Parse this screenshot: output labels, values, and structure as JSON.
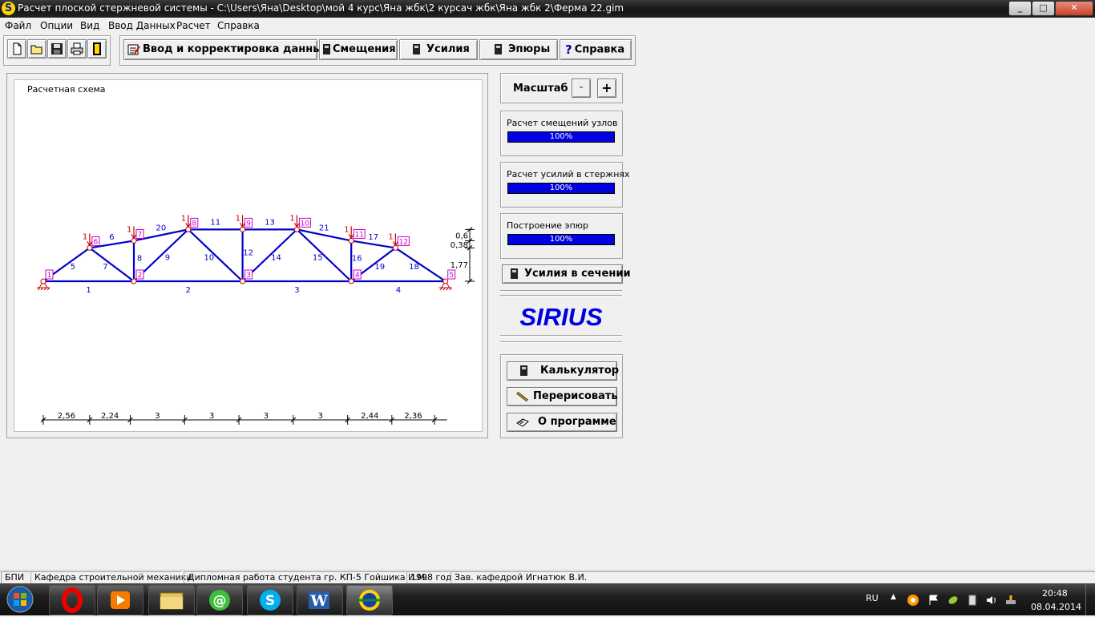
{
  "window": {
    "title": "Расчет плоской стержневой системы - C:\\Users\\Яна\\Desktop\\мой 4 курс\\Яна жбк\\2 курсач жбк\\Яна жбк 2\\Ферма 22.gim",
    "app_icon_letter": "S",
    "minimize": "_",
    "maximize": "□",
    "close": "✕"
  },
  "menu": [
    "Файл",
    "Опции",
    "Вид",
    "Ввод Данных",
    "Расчет",
    "Справка"
  ],
  "toolbar": {
    "file_buttons": [
      "new-file-icon",
      "open-folder-icon",
      "save-disk-icon",
      "print-icon",
      "exit-door-icon"
    ],
    "input_label": "Ввод и корректировка данных",
    "displacements_label": "Смещения",
    "forces_label": "Усилия",
    "diagrams_label": "Эпюры",
    "help_label": "Справка"
  },
  "canvas": {
    "title": "Расчетная схема"
  },
  "truss": {
    "colors": {
      "member": "#0000c8",
      "load": "#c80000",
      "label": "#c800c8",
      "dims": "#000000"
    },
    "loads_value": "1",
    "nodes": [
      {
        "id": "1",
        "x": 0,
        "y": 0
      },
      {
        "id": "2",
        "x": 5.0,
        "y": 0
      },
      {
        "id": "3",
        "x": 11.0,
        "y": 0
      },
      {
        "id": "4",
        "x": 17.0,
        "y": 0
      },
      {
        "id": "5",
        "x": 22.2,
        "y": 0
      },
      {
        "id": "6",
        "x": 2.56,
        "y": 1.77
      },
      {
        "id": "7",
        "x": 5.0,
        "y": 2.15
      },
      {
        "id": "8",
        "x": 8.0,
        "y": 2.75
      },
      {
        "id": "9",
        "x": 11.0,
        "y": 2.75
      },
      {
        "id": "10",
        "x": 14.0,
        "y": 2.75
      },
      {
        "id": "11",
        "x": 17.0,
        "y": 2.15
      },
      {
        "id": "12",
        "x": 19.44,
        "y": 1.77
      }
    ],
    "members": [
      {
        "id": "1",
        "from": "1",
        "to": "2"
      },
      {
        "id": "2",
        "from": "2",
        "to": "3"
      },
      {
        "id": "3",
        "from": "3",
        "to": "4"
      },
      {
        "id": "4",
        "from": "4",
        "to": "5"
      },
      {
        "id": "5",
        "from": "1",
        "to": "6"
      },
      {
        "id": "6",
        "from": "6",
        "to": "7"
      },
      {
        "id": "7",
        "from": "6",
        "to": "2"
      },
      {
        "id": "8",
        "from": "2",
        "to": "7"
      },
      {
        "id": "9",
        "from": "2",
        "to": "8"
      },
      {
        "id": "20",
        "from": "7",
        "to": "8"
      },
      {
        "id": "10",
        "from": "8",
        "to": "3"
      },
      {
        "id": "11",
        "from": "8",
        "to": "9"
      },
      {
        "id": "12",
        "from": "3",
        "to": "9"
      },
      {
        "id": "13",
        "from": "9",
        "to": "10"
      },
      {
        "id": "14",
        "from": "3",
        "to": "10"
      },
      {
        "id": "15",
        "from": "10",
        "to": "4"
      },
      {
        "id": "21",
        "from": "10",
        "to": "11"
      },
      {
        "id": "16",
        "from": "4",
        "to": "11"
      },
      {
        "id": "17",
        "from": "11",
        "to": "12"
      },
      {
        "id": "19",
        "from": "4",
        "to": "12"
      },
      {
        "id": "18",
        "from": "12",
        "to": "5"
      }
    ],
    "loaded_nodes": [
      "6",
      "7",
      "8",
      "9",
      "10",
      "11",
      "12"
    ],
    "supports": [
      "1",
      "5"
    ],
    "bottom_dims": [
      "2,56",
      "2,24",
      "3",
      "3",
      "3",
      "3",
      "2,44",
      "2,36"
    ],
    "bottom_dim_lengths": [
      2.56,
      2.24,
      3,
      3,
      3,
      3,
      2.44,
      2.36
    ],
    "side_dims": [
      "0,6",
      "0,38",
      "1,77"
    ],
    "side_dim_lengths": [
      0.6,
      0.38,
      1.77
    ]
  },
  "scale": {
    "label": "Масштаб",
    "minus": "-",
    "plus": "+"
  },
  "progress": [
    {
      "label": "Расчет смещений узлов",
      "value": "100%",
      "fraction": 1.0
    },
    {
      "label": "Расчет усилий в стержнях",
      "value": "100%",
      "fraction": 1.0
    },
    {
      "label": "Построение эпюр",
      "value": "100%",
      "fraction": 1.0
    }
  ],
  "section_forces_label": "Усилия в сечении",
  "brand": "SIRIUS",
  "tools": {
    "calculator_label": "Калькулятор",
    "redraw_label": "Перерисовать",
    "about_label": "О программе"
  },
  "status": [
    "БПИ",
    "Кафедра строительной механики",
    "Дипломная работа студента гр. КП-5 Гойшика И.М.",
    "1998 год",
    "Зав. кафедрой Игнатюк В.И."
  ],
  "taskbar": {
    "apps": [
      "start-orb-icon",
      "opera-icon",
      "media-player-icon",
      "explorer-folder-icon",
      "mail-agent-icon",
      "skype-icon",
      "word-icon",
      "sirius-icon"
    ],
    "lang": "RU",
    "time": "20:48",
    "date": "08.04.2014"
  }
}
